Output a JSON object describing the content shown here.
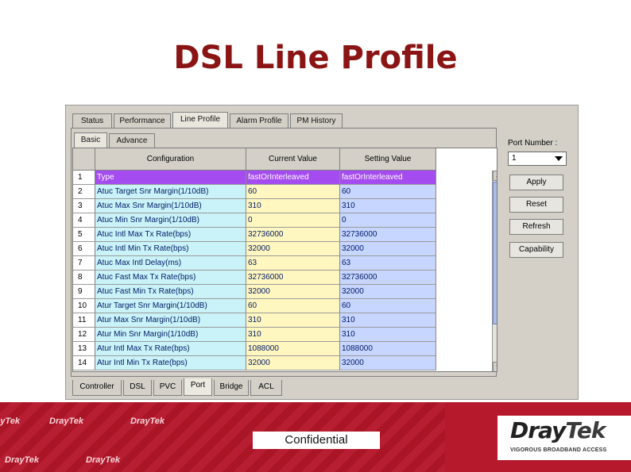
{
  "slide": {
    "title": "DSL Line Profile"
  },
  "top_tabs": [
    "Status",
    "Performance",
    "Line Profile",
    "Alarm Profile",
    "PM History"
  ],
  "sub_tabs": [
    "Basic",
    "Advance"
  ],
  "table": {
    "headers": [
      "Configuration",
      "Current Value",
      "Setting Value"
    ],
    "rows": [
      {
        "index": "1",
        "configuration": "Type",
        "current": "fastOrInterleaved",
        "setting": "fastOrInterleaved"
      },
      {
        "index": "2",
        "configuration": "Atuc Target Snr Margin(1/10dB)",
        "current": "60",
        "setting": "60"
      },
      {
        "index": "3",
        "configuration": "Atuc Max Snr Margin(1/10dB)",
        "current": "310",
        "setting": "310"
      },
      {
        "index": "4",
        "configuration": "Atuc Min Snr Margin(1/10dB)",
        "current": "0",
        "setting": "0"
      },
      {
        "index": "5",
        "configuration": "Atuc Intl Max Tx Rate(bps)",
        "current": "32736000",
        "setting": "32736000"
      },
      {
        "index": "6",
        "configuration": "Atuc Intl Min Tx Rate(bps)",
        "current": "32000",
        "setting": "32000"
      },
      {
        "index": "7",
        "configuration": "Atuc Max Intl Delay(ms)",
        "current": "63",
        "setting": "63"
      },
      {
        "index": "8",
        "configuration": "Atuc Fast Max Tx Rate(bps)",
        "current": "32736000",
        "setting": "32736000"
      },
      {
        "index": "9",
        "configuration": "Atuc Fast Min Tx Rate(bps)",
        "current": "32000",
        "setting": "32000"
      },
      {
        "index": "10",
        "configuration": "Atur Target Snr Margin(1/10dB)",
        "current": "60",
        "setting": "60"
      },
      {
        "index": "11",
        "configuration": "Atur Max Snr Margin(1/10dB)",
        "current": "310",
        "setting": "310"
      },
      {
        "index": "12",
        "configuration": "Atur Min Snr Margin(1/10dB)",
        "current": "310",
        "setting": "310"
      },
      {
        "index": "13",
        "configuration": "Atur Intl Max Tx Rate(bps)",
        "current": "1088000",
        "setting": "1088000"
      },
      {
        "index": "14",
        "configuration": "Atur Intl Min Tx Rate(bps)",
        "current": "32000",
        "setting": "32000"
      }
    ]
  },
  "port": {
    "label": "Port Number :",
    "selected": "1"
  },
  "buttons": {
    "apply": "Apply",
    "reset": "Reset",
    "refresh": "Refresh",
    "capability": "Capability"
  },
  "bottom_tabs": [
    "Controller",
    "DSL",
    "PVC",
    "Port",
    "Bridge",
    "ACL"
  ],
  "footer": {
    "confidential": "Confidential",
    "logo_dray": "Dray",
    "logo_tek": "Tek",
    "tagline": "VIGOROUS BROADBAND ACCESS",
    "watermark": "DrayTek"
  },
  "colors": {
    "title": "#8b1414",
    "band": "#b5192b",
    "row_selected": "#a54cf0",
    "col_configuration": "#c9f3f8",
    "col_current": "#fff7bf",
    "col_setting": "#c7d6ff"
  }
}
